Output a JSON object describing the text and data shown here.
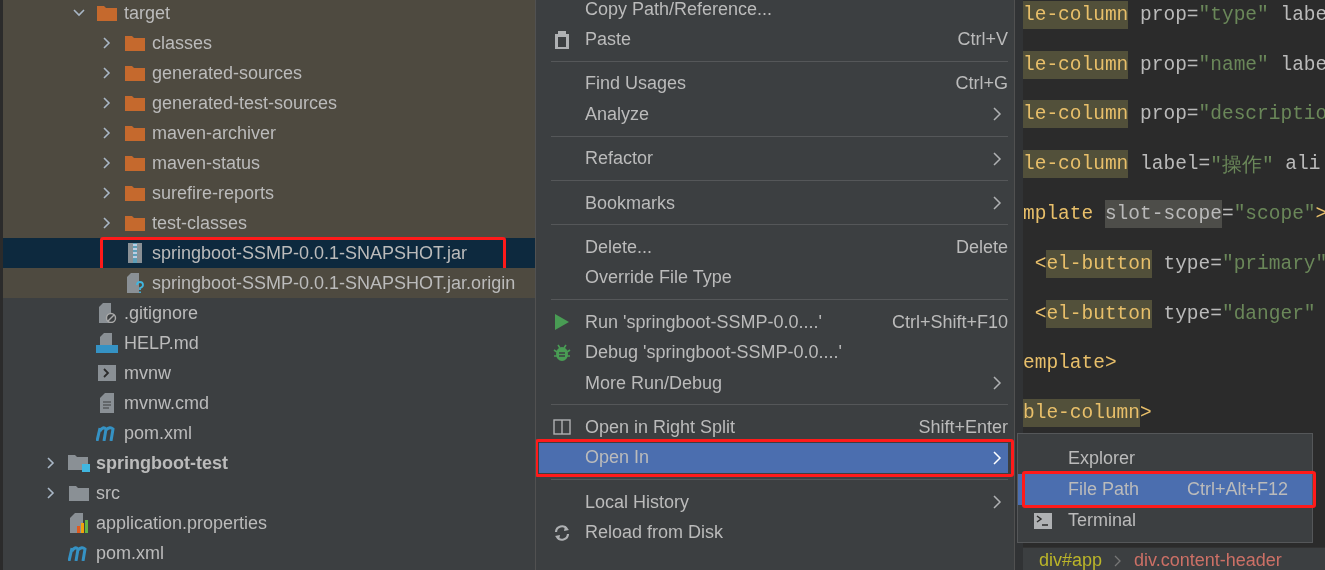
{
  "tree": {
    "inner_items": [
      {
        "name": "target",
        "kind": "folder",
        "expanded": true,
        "selected": false,
        "highlighted": true,
        "children": [
          {
            "name": "classes",
            "kind": "folder",
            "expanded": false,
            "selected": false,
            "highlighted": true
          },
          {
            "name": "generated-sources",
            "kind": "folder",
            "expanded": false,
            "selected": false,
            "highlighted": true
          },
          {
            "name": "generated-test-sources",
            "kind": "folder",
            "expanded": false,
            "selected": false,
            "highlighted": true
          },
          {
            "name": "maven-archiver",
            "kind": "folder",
            "expanded": false,
            "selected": false,
            "highlighted": true
          },
          {
            "name": "maven-status",
            "kind": "folder",
            "expanded": false,
            "selected": false,
            "highlighted": true
          },
          {
            "name": "surefire-reports",
            "kind": "folder",
            "expanded": false,
            "selected": false,
            "highlighted": true
          },
          {
            "name": "test-classes",
            "kind": "folder",
            "expanded": false,
            "selected": false,
            "highlighted": true
          },
          {
            "name": "springboot-SSMP-0.0.1-SNAPSHOT.jar",
            "kind": "jar",
            "selected": true,
            "highlighted": true,
            "annotated": true
          },
          {
            "name": "springboot-SSMP-0.0.1-SNAPSHOT.jar.origin",
            "kind": "unknown",
            "selected": false,
            "highlighted": true
          }
        ]
      },
      {
        "name": ".gitignore",
        "kind": "ignore",
        "selected": false,
        "highlighted": false
      },
      {
        "name": "HELP.md",
        "kind": "markdown",
        "selected": false,
        "highlighted": false
      },
      {
        "name": "mvnw",
        "kind": "shell",
        "selected": false,
        "highlighted": false
      },
      {
        "name": "mvnw.cmd",
        "kind": "text",
        "selected": false,
        "highlighted": false
      },
      {
        "name": "pom.xml",
        "kind": "maven",
        "selected": false,
        "highlighted": false
      }
    ],
    "outer_items": [
      {
        "name": "springboot-test",
        "kind": "module",
        "bold": true,
        "expanded": false,
        "selected": false,
        "highlighted": false
      },
      {
        "name": "src",
        "kind": "grayfolder",
        "expanded": false,
        "selected": false,
        "highlighted": false
      },
      {
        "name": "application.properties",
        "kind": "properties",
        "selected": false,
        "highlighted": false
      },
      {
        "name": "pom.xml",
        "kind": "maven",
        "selected": false,
        "highlighted": false
      }
    ]
  },
  "menu": {
    "groups": [
      [
        {
          "label": "Copy Path/Reference...",
          "selected": false
        },
        {
          "label": "Paste",
          "kind": "paste",
          "shortcut": "Ctrl+V",
          "selected": false
        }
      ],
      [
        {
          "label": "Find Usages",
          "shortcut": "Ctrl+G",
          "selected": false
        },
        {
          "label": "Analyze",
          "submenu": true,
          "selected": false
        }
      ],
      [
        {
          "label": "Refactor",
          "submenu": true,
          "selected": false
        }
      ],
      [
        {
          "label": "Bookmarks",
          "submenu": true,
          "selected": false
        }
      ],
      [
        {
          "label": "Delete...",
          "shortcut": "Delete",
          "selected": false
        },
        {
          "label": "Override File Type",
          "selected": false
        }
      ],
      [
        {
          "label": "Run 'springboot-SSMP-0.0....'",
          "kind": "run",
          "shortcut": "Ctrl+Shift+F10",
          "selected": false
        },
        {
          "label": "Debug 'springboot-SSMP-0.0....'",
          "kind": "debug",
          "selected": false
        },
        {
          "label": "More Run/Debug",
          "submenu": true,
          "selected": false
        }
      ],
      [
        {
          "label": "Open in Right Split",
          "kind": "split",
          "shortcut": "Shift+Enter",
          "selected": false
        },
        {
          "label": "Open In",
          "submenu": true,
          "selected": true,
          "annotated": true
        }
      ],
      [
        {
          "label": "Local History",
          "submenu": true,
          "selected": false
        },
        {
          "label": "Reload from Disk",
          "kind": "reload",
          "selected": false
        }
      ]
    ]
  },
  "submenu": {
    "items": [
      {
        "label": "Explorer",
        "selected": false
      },
      {
        "label": "File Path",
        "shortcut": "Ctrl+Alt+F12",
        "selected": true,
        "annotated": true
      },
      {
        "label": "Terminal",
        "kind": "terminal",
        "selected": false
      }
    ]
  },
  "editor": {
    "lines": [
      [
        {
          "text": "le-column",
          "kind": "tag_hl"
        },
        {
          "text": " prop=",
          "kind": "attr"
        },
        {
          "text": "\"type\"",
          "kind": "string"
        },
        {
          "text": " labe",
          "kind": "attr"
        }
      ],
      [
        {
          "text": "le-column",
          "kind": "tag_hl"
        },
        {
          "text": " prop=",
          "kind": "attr"
        },
        {
          "text": "\"name\"",
          "kind": "string"
        },
        {
          "text": " labe",
          "kind": "attr"
        }
      ],
      [
        {
          "text": "le-column",
          "kind": "tag_hl"
        },
        {
          "text": " prop=",
          "kind": "attr"
        },
        {
          "text": "\"descriptio",
          "kind": "string"
        }
      ],
      [
        {
          "text": "le-column",
          "kind": "tag_hl"
        },
        {
          "text": " label=",
          "kind": "attr"
        },
        {
          "text": "\"操作\"",
          "kind": "string"
        },
        {
          "text": " ali",
          "kind": "attr"
        }
      ],
      [
        {
          "text": "mplate ",
          "kind": "tag"
        },
        {
          "text": "slot-scope",
          "kind": "attr_hl"
        },
        {
          "text": "=",
          "kind": "attr"
        },
        {
          "text": "\"scope\"",
          "kind": "string"
        },
        {
          "text": ">",
          "kind": "tag"
        }
      ],
      [
        {
          "text": " <",
          "kind": "tag"
        },
        {
          "text": "el-button",
          "kind": "tag_hl"
        },
        {
          "text": " type=",
          "kind": "attr"
        },
        {
          "text": "\"primary\"",
          "kind": "string"
        }
      ],
      [
        {
          "text": " <",
          "kind": "tag"
        },
        {
          "text": "el-button",
          "kind": "tag_hl"
        },
        {
          "text": " type=",
          "kind": "attr"
        },
        {
          "text": "\"danger\"",
          "kind": "string"
        }
      ],
      [
        {
          "text": "emplate>",
          "kind": "tag"
        }
      ],
      [
        {
          "text": "ble-column",
          "kind": "tag_hl"
        },
        {
          "text": ">",
          "kind": "tag"
        }
      ]
    ],
    "breadcrumbs": [
      {
        "label": "div#app",
        "color": "#bbb529"
      },
      {
        "label": "div.content-header",
        "color": "#cc7066"
      }
    ]
  }
}
